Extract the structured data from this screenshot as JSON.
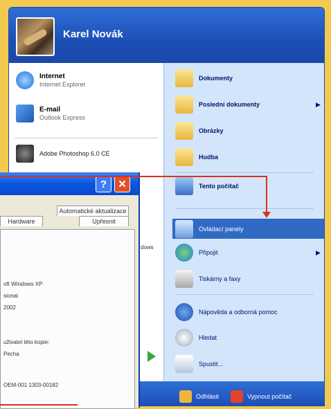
{
  "user": {
    "name": "Karel Novák"
  },
  "pinned": [
    {
      "title": "Internet",
      "subtitle": "Internet Explorer",
      "icon": "internet-explorer-icon"
    },
    {
      "title": "E-mail",
      "subtitle": "Outlook Express",
      "icon": "outlook-express-icon"
    }
  ],
  "recent": [
    {
      "title": "Adobe Photoshop 6.0 CE",
      "icon": "photoshop-icon"
    }
  ],
  "right_items": [
    {
      "label": "Dokumenty",
      "icon": "folder-icon"
    },
    {
      "label": "Poslední dokumenty",
      "icon": "recent-documents-icon"
    },
    {
      "label": "Obrázky",
      "icon": "pictures-folder-icon"
    },
    {
      "label": "Hudba",
      "icon": "music-folder-icon"
    },
    {
      "label": "Tento počítač",
      "icon": "my-computer-icon"
    },
    {
      "label": "Ovládací panely",
      "icon": "control-panel-icon"
    },
    {
      "label": "Připojit",
      "icon": "connect-icon"
    },
    {
      "label": "Tiskárny a faxy",
      "icon": "printer-icon"
    },
    {
      "label": "Nápověda a odborná pomoc",
      "icon": "help-icon"
    },
    {
      "label": "Hledat",
      "icon": "search-icon"
    },
    {
      "label": "Spustit...",
      "icon": "run-icon"
    }
  ],
  "footer": {
    "logoff": "Odhlásit",
    "shutdown": "Vypnout počítač"
  },
  "dialog": {
    "tabs": [
      "Automatické aktualizace",
      "Hardware",
      "Upřesnit"
    ],
    "peek_text": "dows",
    "lines": [
      "oft Windows XP",
      "sional",
      "2002",
      "uživatel této kopie:",
      "Pecha",
      "OEM-001 1303-00182"
    ]
  },
  "colors": {
    "accent": "#316ac5",
    "header": "#1d4fb7",
    "annotation": "#d8321e",
    "frame": "#f3c94f"
  }
}
